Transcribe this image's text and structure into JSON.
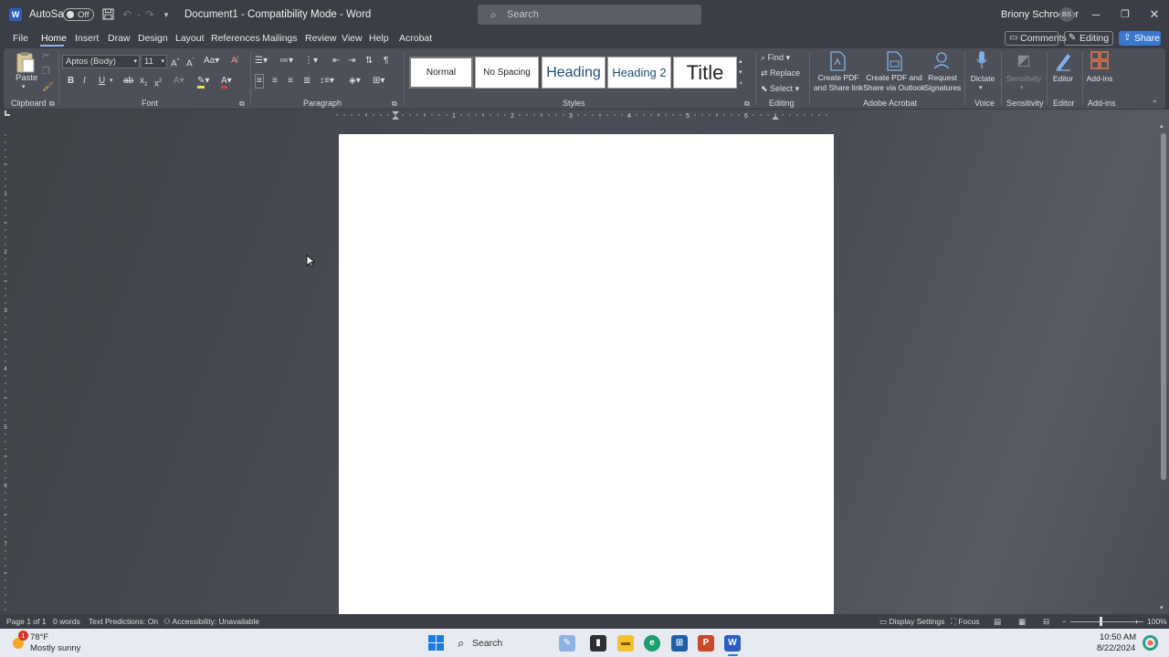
{
  "titlebar": {
    "autosave_label": "AutoSave",
    "autosave_state": "Off",
    "doc_title": "Document1  -  Compatibility Mode  -  Word",
    "search_placeholder": "Search",
    "user_name": "Briony Schroeder",
    "user_initials": "BS",
    "app_icon": "W"
  },
  "menu": {
    "tabs": [
      "File",
      "Home",
      "Insert",
      "Draw",
      "Design",
      "Layout",
      "References",
      "Mailings",
      "Review",
      "View",
      "Help",
      "Acrobat"
    ],
    "active_tab": "Home",
    "comments_label": "Comments",
    "editing_label": "Editing",
    "share_label": "Share"
  },
  "ribbon": {
    "clipboard": {
      "paste_label": "Paste",
      "group_label": "Clipboard"
    },
    "font": {
      "font_name": "Aptos (Body)",
      "font_size": "11",
      "group_label": "Font"
    },
    "paragraph": {
      "group_label": "Paragraph"
    },
    "styles": {
      "items": [
        "Normal",
        "No Spacing",
        "Heading",
        "Heading 2",
        "Title"
      ],
      "group_label": "Styles"
    },
    "editing": {
      "find_label": "Find",
      "replace_label": "Replace",
      "select_label": "Select",
      "group_label": "Editing"
    },
    "acrobat": {
      "create_pdf_share_link": [
        "Create PDF",
        "and Share link"
      ],
      "create_pdf_outlook": [
        "Create PDF and",
        "Share via Outlook"
      ],
      "request_signatures": [
        "Request",
        "Signatures"
      ],
      "group_label": "Adobe Acrobat"
    },
    "voice": {
      "dictate_label": "Dictate",
      "group_label": "Voice"
    },
    "sensitivity": {
      "label": "Sensitivity",
      "group_label": "Sensitivity"
    },
    "editor": {
      "label": "Editor",
      "group_label": "Editor"
    },
    "addins": {
      "label": "Add-ins",
      "group_label": "Add-ins"
    }
  },
  "ruler": {
    "numbers": [
      "1",
      "2",
      "3",
      "4",
      "5",
      "6"
    ],
    "left_numbers": [
      "1",
      "2",
      "3",
      "4",
      "5",
      "6",
      "7"
    ]
  },
  "status": {
    "page": "Page 1 of 1",
    "words": "0 words",
    "text_predictions": "Text Predictions: On",
    "accessibility": "Accessibility: Unavailable",
    "display_settings": "Display Settings",
    "focus": "Focus",
    "zoom": "100%"
  },
  "taskbar": {
    "weather_temp": "78°F",
    "weather_desc": "Mostly sunny",
    "weather_badge": "1",
    "search_placeholder": "Search",
    "time": "10:50 AM",
    "date": "8/22/2024"
  }
}
